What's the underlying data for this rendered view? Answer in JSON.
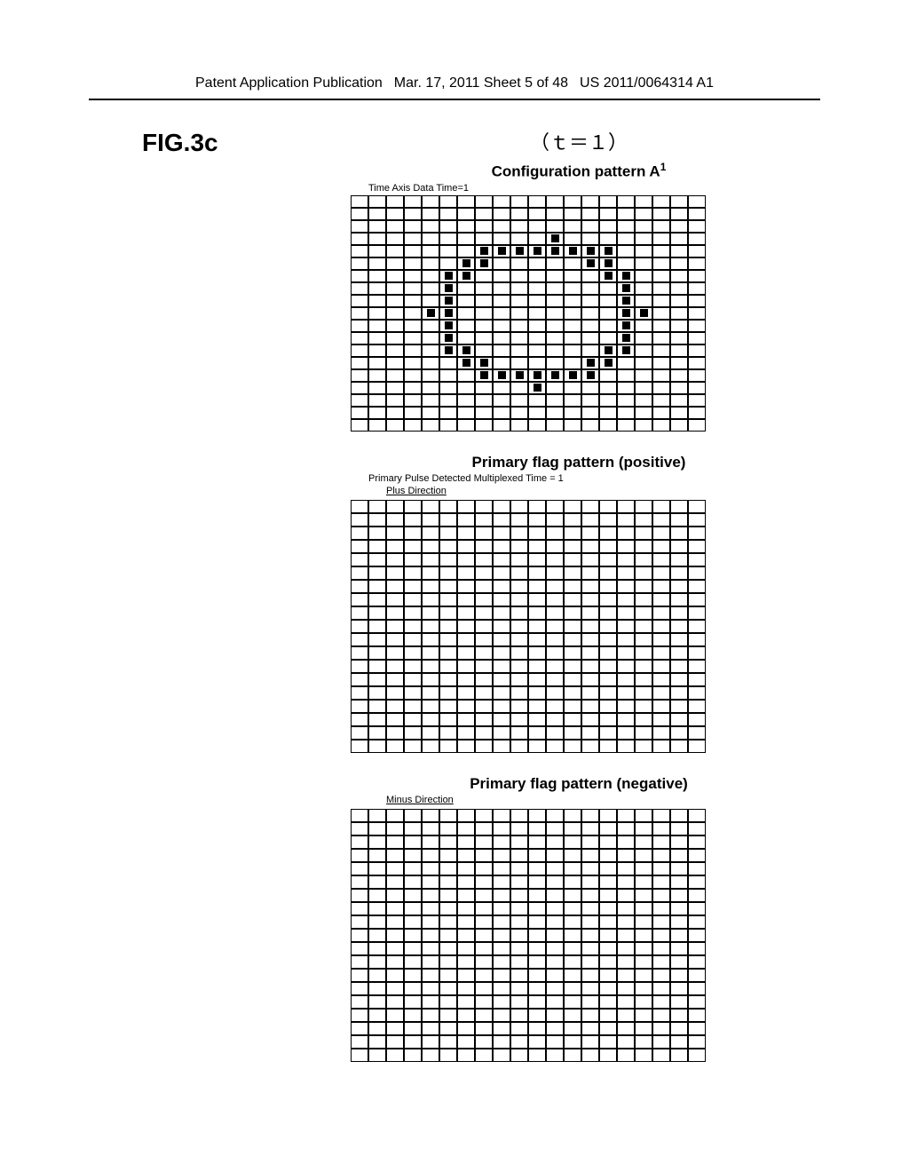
{
  "header": {
    "left": "Patent Application Publication",
    "center": "Mar. 17, 2011 Sheet 5 of 48",
    "right": "US 2011/0064314 A1"
  },
  "figureLabel": "FIG.3c",
  "tLine": "（ｔ＝１）",
  "grid1": {
    "title_prefix": "Configuration pattern A",
    "title_sup": "1",
    "subtitle": "Time Axis Data  Time=1",
    "rows": 19,
    "cols": 20,
    "filled": [
      [
        3,
        11
      ],
      [
        4,
        7
      ],
      [
        4,
        8
      ],
      [
        4,
        9
      ],
      [
        4,
        10
      ],
      [
        4,
        11
      ],
      [
        4,
        12
      ],
      [
        4,
        13
      ],
      [
        4,
        14
      ],
      [
        5,
        6
      ],
      [
        5,
        7
      ],
      [
        5,
        13
      ],
      [
        5,
        14
      ],
      [
        6,
        5
      ],
      [
        6,
        6
      ],
      [
        6,
        14
      ],
      [
        6,
        15
      ],
      [
        7,
        5
      ],
      [
        7,
        15
      ],
      [
        8,
        5
      ],
      [
        8,
        15
      ],
      [
        9,
        4
      ],
      [
        9,
        5
      ],
      [
        9,
        15
      ],
      [
        9,
        16
      ],
      [
        10,
        5
      ],
      [
        10,
        15
      ],
      [
        11,
        5
      ],
      [
        11,
        15
      ],
      [
        12,
        5
      ],
      [
        12,
        6
      ],
      [
        12,
        14
      ],
      [
        12,
        15
      ],
      [
        13,
        6
      ],
      [
        13,
        7
      ],
      [
        13,
        13
      ],
      [
        13,
        14
      ],
      [
        14,
        7
      ],
      [
        14,
        8
      ],
      [
        14,
        9
      ],
      [
        14,
        10
      ],
      [
        14,
        11
      ],
      [
        14,
        12
      ],
      [
        14,
        13
      ],
      [
        15,
        10
      ]
    ]
  },
  "grid2": {
    "title": "Primary flag pattern (positive)",
    "subtitle": "Primary Pulse Detected Multiplexed   Time = 1",
    "direction": "Plus Direction",
    "rows": 19,
    "cols": 20,
    "filled": []
  },
  "grid3": {
    "title": "Primary flag pattern (negative)",
    "direction": "Minus Direction",
    "rows": 19,
    "cols": 20,
    "filled": []
  }
}
